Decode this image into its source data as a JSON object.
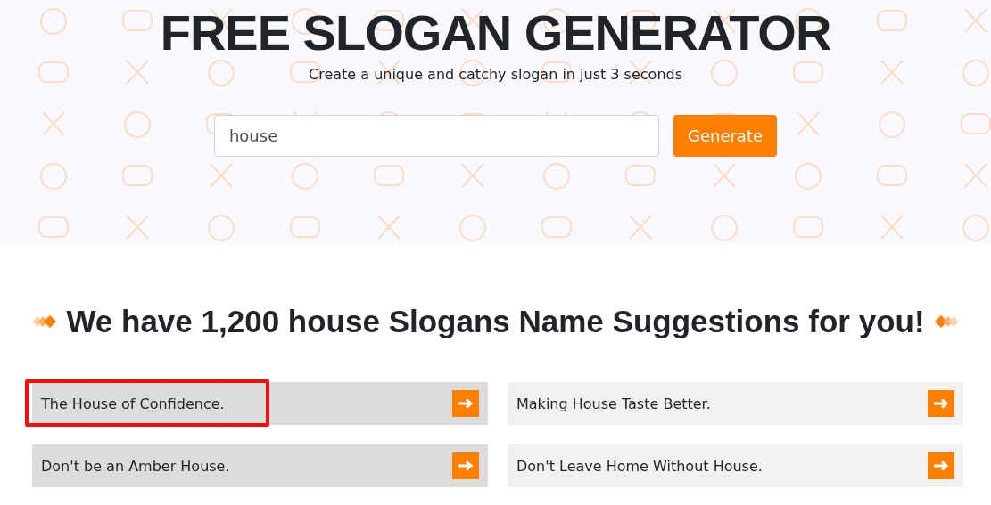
{
  "hero": {
    "title": "FREE SLOGAN GENERATOR",
    "subtitle": "Create a unique and catchy slogan in just 3 seconds",
    "search": {
      "value": "house"
    },
    "button": "Generate"
  },
  "results": {
    "heading": "We have 1,200 house Slogans Name Suggestions for you!",
    "slogans": [
      {
        "text": "The House of Confidence.",
        "highlighted": true,
        "outlined": true
      },
      {
        "text": "Making House Taste Better.",
        "highlighted": false,
        "outlined": false
      },
      {
        "text": "Don't be an Amber House.",
        "highlighted": true,
        "outlined": false
      },
      {
        "text": "Don't Leave Home Without House.",
        "highlighted": false,
        "outlined": false
      }
    ]
  }
}
